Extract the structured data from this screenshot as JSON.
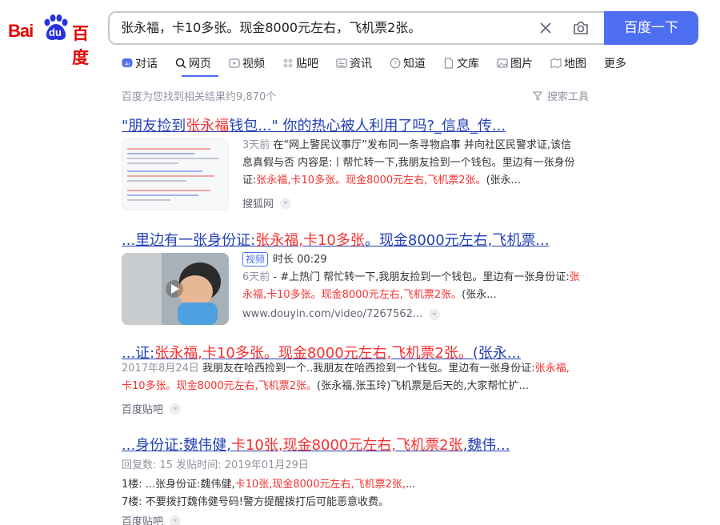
{
  "logo": {
    "bai": "Bai",
    "du": "du",
    "baidu": "百度"
  },
  "search": {
    "query": "张永福，卡10多张。现金8000元左右，飞机票2张。",
    "button": "百度一下"
  },
  "tabs": [
    {
      "label": "对话",
      "icon": "ai-chat-icon"
    },
    {
      "label": "网页",
      "icon": "search-icon"
    },
    {
      "label": "视频",
      "icon": "video-icon"
    },
    {
      "label": "贴吧",
      "icon": "tieba-icon"
    },
    {
      "label": "资讯",
      "icon": "news-icon"
    },
    {
      "label": "知道",
      "icon": "question-icon"
    },
    {
      "label": "文库",
      "icon": "doc-icon"
    },
    {
      "label": "图片",
      "icon": "image-icon"
    },
    {
      "label": "地图",
      "icon": "map-icon"
    },
    {
      "label": "更多",
      "icon": ""
    }
  ],
  "result_count": "百度为您找到相关结果约9,870个",
  "tools": "搜索工具",
  "results": [
    {
      "title_a": "\"朋友捡到",
      "title_b": "张永福",
      "title_c": "钱包...\" 你的热心被人利用了吗?_信息_传...",
      "date": "3天前",
      "snippet_1": "在“网上警民议事厅”发布同一条寻物启事 并向社区民警求证,该信",
      "snippet_2": "息真假与否 内容是:丨帮忙转一下,我朋友捡到一个钱包。里边有一张身份",
      "snippet_3a": "证:",
      "snippet_3b": "张永福,卡10多张。现金8000元左右,飞机票2张。",
      "snippet_3c": "(张永...",
      "source": "搜狐网"
    },
    {
      "title_a": "...里边有一张身份证:",
      "title_b": "张永福,卡10多张",
      "title_c": "。现金8000元左右,飞机票...",
      "video_tag": "视频",
      "duration": "时长 00:29",
      "date": "6天前",
      "snippet_1a": "- #上热门 帮忙转一下,我朋友捡到一个钱包。里边有一张身份证:",
      "snippet_1b": "张",
      "snippet_2a": "永福,卡10多张。现金8000元左右,飞机票2张。",
      "snippet_2b": "(张永...",
      "source": "www.douyin.com/video/7267562..."
    },
    {
      "title_a": "...证:",
      "title_b": "张永福,卡10多张。现金8000元左右,飞机票2张。",
      "title_c": "(张永...",
      "date": "2017年8月24日",
      "snippet_1a": "我朋友在哈西捡到一个..我朋友在哈西捡到一个钱包。里边有一张身份证:",
      "snippet_1b": "张永福,",
      "snippet_2a": "卡10多张。现金8000元左右,飞机票2张。",
      "snippet_2b": "(张永福,张玉玲)飞机票是后天的,大家帮忙扩...",
      "source": "百度贴吧"
    },
    {
      "title_a": "...身份证:魏伟健,",
      "title_b": "卡10张,现金8000元左右,飞机票2张",
      "title_c": ",魏伟...",
      "meta": "回复数: 15 发贴时间: 2019年01月29日",
      "floor1_a": "1楼: ...张身份证:魏伟健,",
      "floor1_b": "卡10张,现金8000元左右,飞机票2张,",
      "floor1_c": "...",
      "floor2": "7楼: 不要拨打魏伟健号码!警方提醒拨打后可能恶意收费。",
      "source": "百度贴吧"
    }
  ]
}
